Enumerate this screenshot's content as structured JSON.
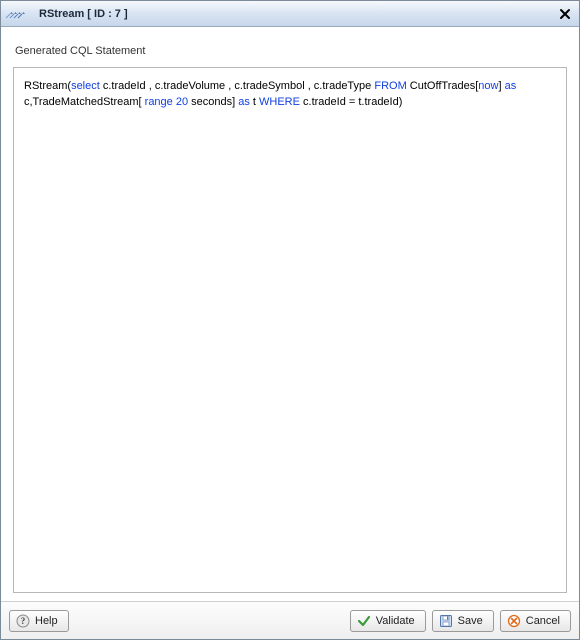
{
  "dialog": {
    "title": "RStream [ ID : 7 ]"
  },
  "section": {
    "label": "Generated CQL Statement"
  },
  "cql": {
    "tokens": [
      {
        "t": "RStream(",
        "k": false
      },
      {
        "t": "select",
        "k": true
      },
      {
        "t": " c.tradeId , c.tradeVolume , c.tradeSymbol , c.tradeType ",
        "k": false
      },
      {
        "t": " FROM",
        "k": true
      },
      {
        "t": " CutOffTrades[",
        "k": false
      },
      {
        "t": "now",
        "k": true
      },
      {
        "t": "] ",
        "k": false
      },
      {
        "t": "as",
        "k": true
      },
      {
        "t": " c,TradeMatchedStream[",
        "k": false
      },
      {
        "t": " range 20",
        "k": true
      },
      {
        "t": " seconds] ",
        "k": false
      },
      {
        "t": "as",
        "k": true
      },
      {
        "t": " t ",
        "k": false
      },
      {
        "t": "WHERE",
        "k": true
      },
      {
        "t": " c.tradeId  =  t.tradeId)",
        "k": false
      }
    ]
  },
  "buttons": {
    "help": "Help",
    "validate": "Validate",
    "save": "Save",
    "cancel": "Cancel"
  }
}
